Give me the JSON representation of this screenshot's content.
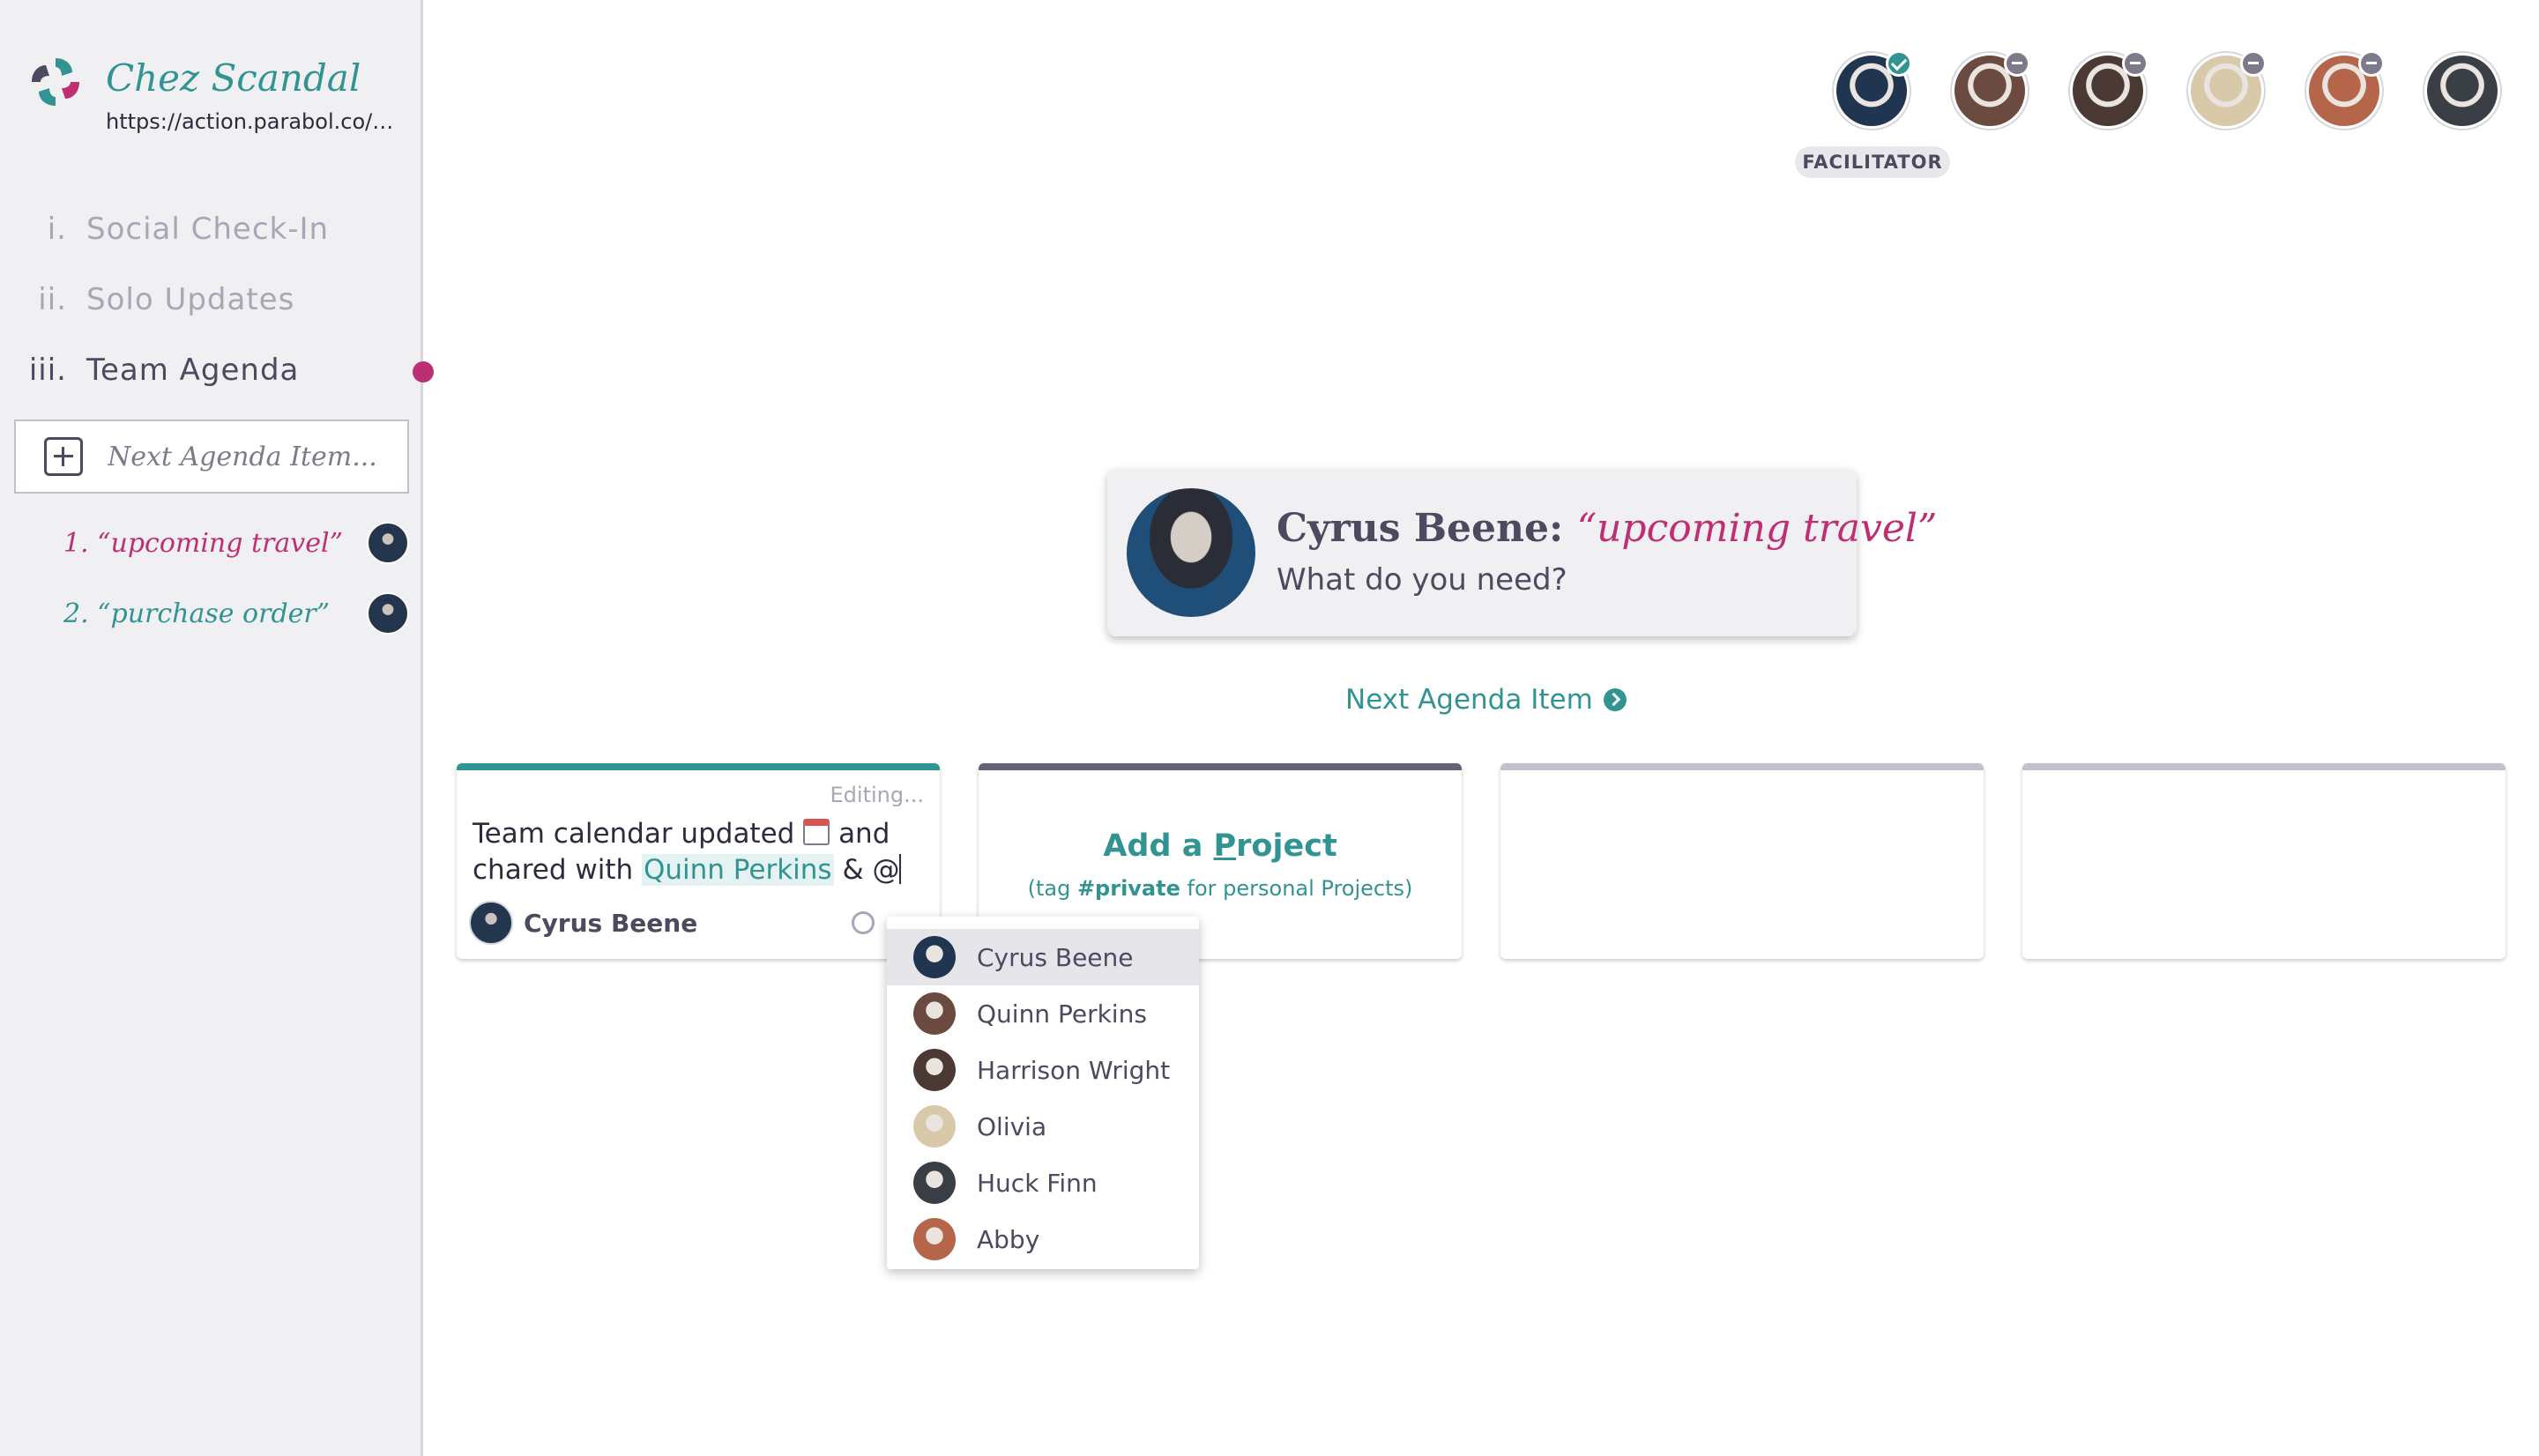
{
  "team": {
    "name": "Chez Scandal",
    "url": "https://action.parabol.co/…"
  },
  "nav": {
    "items": [
      {
        "num": "i.",
        "label": "Social Check-In"
      },
      {
        "num": "ii.",
        "label": "Solo Updates"
      },
      {
        "num": "iii.",
        "label": "Team Agenda"
      }
    ],
    "active_index": 2
  },
  "next_agenda_placeholder": "Next Agenda Item...",
  "agenda_items": [
    {
      "label": "1. “upcoming travel”"
    },
    {
      "label": "2. “purchase order”"
    }
  ],
  "facilitator_label": "FACILITATOR",
  "team_avatars": [
    {
      "name": "Cyrus Beene",
      "status": "check",
      "color": "#1f3550"
    },
    {
      "name": "Quinn Perkins",
      "status": "minus",
      "color": "#6b4a3f"
    },
    {
      "name": "Harrison Wright",
      "status": "minus",
      "color": "#4a3a33"
    },
    {
      "name": "Olivia",
      "status": "minus",
      "color": "#d8c9a8"
    },
    {
      "name": "Abby",
      "status": "minus",
      "color": "#b5654a"
    },
    {
      "name": "Huck Finn",
      "status": "none",
      "color": "#3a3f45"
    }
  ],
  "prompt": {
    "name": "Cyrus Beene:",
    "topic": "“upcoming travel”",
    "question": "What do you need?"
  },
  "next_agenda_link": "Next Agenda Item",
  "project_card": {
    "status": "Editing...",
    "text_before": "Team calendar updated",
    "text_middle": "and chared with",
    "mention": "Quinn Perkins",
    "text_after": "& @",
    "owner": "Cyrus Beene"
  },
  "add_project": {
    "title_prefix": "Add a ",
    "title_accel": "P",
    "title_suffix": "roject",
    "sub_prefix": "(tag ",
    "sub_tag": "#private",
    "sub_suffix": " for personal Projects)"
  },
  "mention_menu": [
    {
      "name": "Cyrus Beene",
      "color": "#1f3550"
    },
    {
      "name": "Quinn Perkins",
      "color": "#6b4a3f"
    },
    {
      "name": "Harrison Wright",
      "color": "#4a3a33"
    },
    {
      "name": "Olivia",
      "color": "#d8c9a8"
    },
    {
      "name": "Huck Finn",
      "color": "#3a3f45"
    },
    {
      "name": "Abby",
      "color": "#b5654a"
    }
  ],
  "colors": {
    "teal": "#329492",
    "pink": "#bd2f72",
    "dark": "#4e495f",
    "column_bars": [
      "#329492",
      "#666277",
      "#c3c0cc",
      "#c3c0cc"
    ]
  }
}
